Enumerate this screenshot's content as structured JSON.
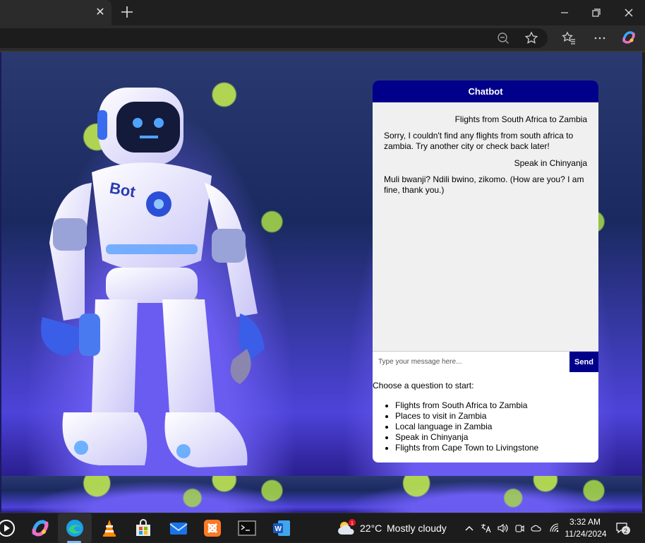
{
  "browser": {
    "tab_close_glyph": "✕",
    "toolbar_icons": [
      "zoom-out-icon",
      "favorite-star-icon",
      "favorites-list-icon",
      "more-icon",
      "copilot-icon"
    ]
  },
  "chatbot": {
    "title": "Chatbot",
    "messages": [
      {
        "role": "user",
        "text": "Flights from South Africa to Zambia"
      },
      {
        "role": "bot",
        "text": "Sorry, I couldn't find any flights from south africa to zambia. Try another city or check back later!"
      },
      {
        "role": "user",
        "text": "Speak in Chinyanja"
      },
      {
        "role": "bot",
        "text": "Muli bwanji? Ndili bwino, zikomo. (How are you? I am fine, thank you.)"
      }
    ],
    "input_placeholder": "Type your message here...",
    "input_value": "",
    "send_label": "Send",
    "start_prompt": "Choose a question to start:",
    "suggestions": [
      "Flights from South Africa to Zambia",
      "Places to visit in Zambia",
      "Local language in Zambia",
      "Speak in Chinyanja",
      "Flights from Cape Town to Livingstone"
    ],
    "accent_color": "#00008b"
  },
  "robot_label": "Bot",
  "taskbar": {
    "weather_temp": "22°C",
    "weather_desc": "Mostly cloudy",
    "weather_badge": "1",
    "time": "3:32 AM",
    "date": "11/24/2024",
    "notification_count": "2",
    "apps": [
      "media-player-icon",
      "copilot-icon",
      "edge-icon",
      "vlc-icon",
      "microsoft-store-icon",
      "mail-icon",
      "xampp-icon",
      "terminal-icon",
      "word-icon"
    ]
  }
}
